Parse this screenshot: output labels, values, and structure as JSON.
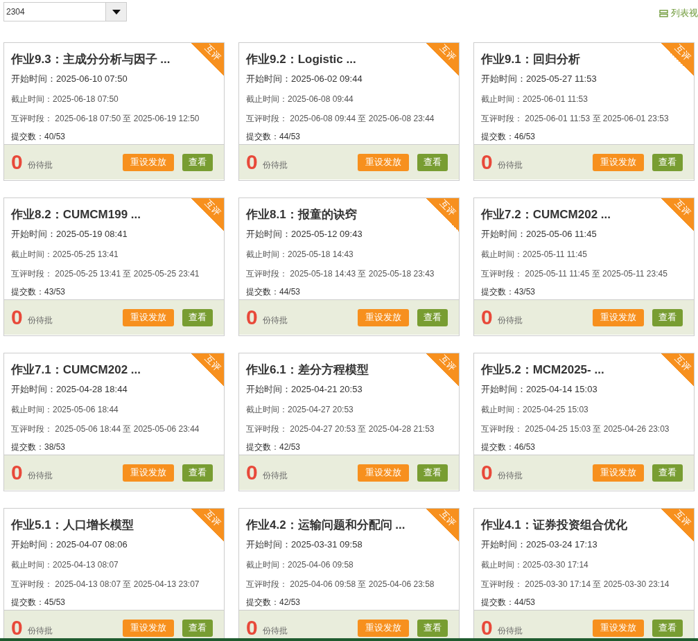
{
  "class_select": {
    "value": "2304"
  },
  "view_toggle": {
    "label": "列表视"
  },
  "assignments": [
    {
      "title": "作业9.3：主成分分析与因子 ...",
      "badge": "互评",
      "start": "开始时间：2025-06-10 07:50",
      "deadline": "截止时间：2025-06-18 07:50",
      "peer_review": "互评时段： 2025-06-18 07:50 至 2025-06-19 12:50",
      "submissions": "提交数：40/53",
      "pending_count": "0",
      "pending_label": "份待批",
      "reset_button": "重设发放",
      "view_button": "查看"
    },
    {
      "title": "作业9.2：Logistic ...",
      "badge": "互评",
      "start": "开始时间：2025-06-02 09:44",
      "deadline": "截止时间：2025-06-08 09:44",
      "peer_review": "互评时段： 2025-06-08 09:44 至 2025-06-08 23:44",
      "submissions": "提交数：44/53",
      "pending_count": "0",
      "pending_label": "份待批",
      "reset_button": "重设发放",
      "view_button": "查看"
    },
    {
      "title": "作业9.1：回归分析",
      "badge": "互评",
      "start": "开始时间：2025-05-27 11:53",
      "deadline": "截止时间：2025-06-01 11:53",
      "peer_review": "互评时段： 2025-06-01 11:53 至 2025-06-01 23:53",
      "submissions": "提交数：46/53",
      "pending_count": "0",
      "pending_label": "份待批",
      "reset_button": "重设发放",
      "view_button": "查看"
    },
    {
      "title": "作业8.2：CUMCM199 ...",
      "badge": "互评",
      "start": "开始时间：2025-05-19 08:41",
      "deadline": "截止时间：2025-05-25 13:41",
      "peer_review": "互评时段： 2025-05-25 13:41 至 2025-05-25 23:41",
      "submissions": "提交数：43/53",
      "pending_count": "0",
      "pending_label": "份待批",
      "reset_button": "重设发放",
      "view_button": "查看"
    },
    {
      "title": "作业8.1：报童的诀窍",
      "badge": "互评",
      "start": "开始时间：2025-05-12 09:43",
      "deadline": "截止时间：2025-05-18 14:43",
      "peer_review": "互评时段： 2025-05-18 14:43 至 2025-05-18 23:43",
      "submissions": "提交数：44/53",
      "pending_count": "0",
      "pending_label": "份待批",
      "reset_button": "重设发放",
      "view_button": "查看"
    },
    {
      "title": "作业7.2：CUMCM202 ...",
      "badge": "互评",
      "start": "开始时间：2025-05-06 11:45",
      "deadline": "截止时间：2025-05-11 11:45",
      "peer_review": "互评时段： 2025-05-11 11:45 至 2025-05-11 23:45",
      "submissions": "提交数：43/53",
      "pending_count": "0",
      "pending_label": "份待批",
      "reset_button": "重设发放",
      "view_button": "查看"
    },
    {
      "title": "作业7.1：CUMCM202 ...",
      "badge": "互评",
      "start": "开始时间：2025-04-28 18:44",
      "deadline": "截止时间：2025-05-06 18:44",
      "peer_review": "互评时段： 2025-05-06 18:44 至 2025-05-06 23:44",
      "submissions": "提交数：38/53",
      "pending_count": "0",
      "pending_label": "份待批",
      "reset_button": "重设发放",
      "view_button": "查看"
    },
    {
      "title": "作业6.1：差分方程模型",
      "badge": "互评",
      "start": "开始时间：2025-04-21 20:53",
      "deadline": "截止时间：2025-04-27 20:53",
      "peer_review": "互评时段： 2025-04-27 20:53 至 2025-04-28 21:53",
      "submissions": "提交数：42/53",
      "pending_count": "0",
      "pending_label": "份待批",
      "reset_button": "重设发放",
      "view_button": "查看"
    },
    {
      "title": "作业5.2：MCM2025- ...",
      "badge": "互评",
      "start": "开始时间：2025-04-14 15:03",
      "deadline": "截止时间：2025-04-25 15:03",
      "peer_review": "互评时段： 2025-04-25 15:03 至 2025-04-26 23:03",
      "submissions": "提交数：46/53",
      "pending_count": "0",
      "pending_label": "份待批",
      "reset_button": "重设发放",
      "view_button": "查看"
    },
    {
      "title": "作业5.1：人口增长模型",
      "badge": "互评",
      "start": "开始时间：2025-04-07 08:06",
      "deadline": "截止时间：2025-04-13 08:07",
      "peer_review": "互评时段： 2025-04-13 08:07 至 2025-04-13 23:07",
      "submissions": "提交数：45/53",
      "pending_count": "0",
      "pending_label": "份待批",
      "reset_button": "重设发放",
      "view_button": "查看"
    },
    {
      "title": "作业4.2：运输问题和分配问 ...",
      "badge": "互评",
      "start": "开始时间：2025-03-31 09:58",
      "deadline": "截止时间：2025-04-06 09:58",
      "peer_review": "互评时段： 2025-04-06 09:58 至 2025-04-06 23:58",
      "submissions": "提交数：42/53",
      "pending_count": "0",
      "pending_label": "份待批",
      "reset_button": "重设发放",
      "view_button": "查看"
    },
    {
      "title": "作业4.1：证券投资组合优化",
      "badge": "互评",
      "start": "开始时间：2025-03-24 17:13",
      "deadline": "截止时间：2025-03-30 17:14",
      "peer_review": "互评时段： 2025-03-30 17:14 至 2025-03-30 23:14",
      "submissions": "提交数：44/53",
      "pending_count": "0",
      "pending_label": "份待批",
      "reset_button": "重设发放",
      "view_button": "查看"
    }
  ]
}
